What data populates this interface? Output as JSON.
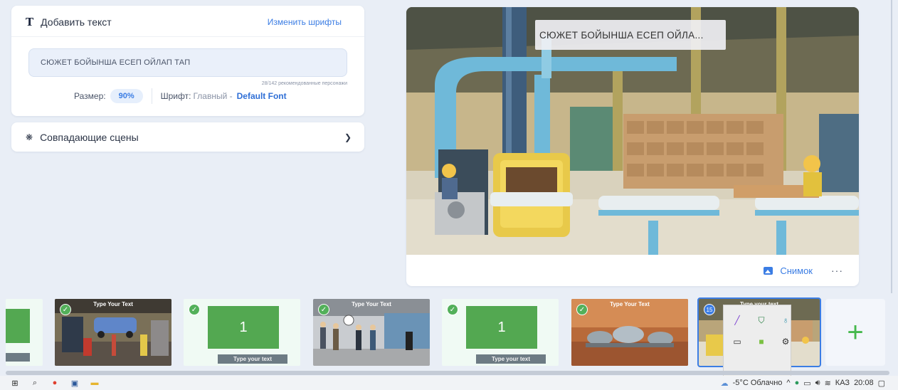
{
  "text_panel": {
    "title": "Добавить текст",
    "change_fonts": "Изменить шрифты",
    "text_value": "СЮЖЕТ БОЙЫНША ЕСЕП ОЙЛАП ТАП",
    "char_count": "28/142 рекомендованные персонажи",
    "size_label": "Размер:",
    "size_value": "90%",
    "font_label": "Шрифт:",
    "font_main": "Главный -",
    "font_name": "Default Font"
  },
  "scenes_panel": {
    "title": "Совпадающие сцены"
  },
  "preview": {
    "caption": "СЮЖЕТ БОЙЫНША ЕСЕП ОЙЛА...",
    "snapshot_label": "Снимок",
    "more": "···"
  },
  "thumbnails": [
    {
      "kind": "green-partial"
    },
    {
      "kind": "garage",
      "title": "Type Your Text",
      "checked": true
    },
    {
      "kind": "green",
      "number": "1",
      "label": "Type your text",
      "checked": true
    },
    {
      "kind": "office",
      "title": "Type Your Text",
      "checked": true
    },
    {
      "kind": "green",
      "number": "1",
      "label": "Type your text",
      "checked": true
    },
    {
      "kind": "mars",
      "title": "Type Your Text",
      "checked": true
    },
    {
      "kind": "factory",
      "title": "Type your text",
      "badge": "15",
      "selected": true
    }
  ],
  "add_button": "+",
  "taskbar": {
    "weather": "-5°C Облачно",
    "lang": "КАЗ",
    "time": "20:08"
  },
  "colors": {
    "accent": "#3b7de4",
    "green": "#53a851",
    "background": "#e9eef6"
  }
}
